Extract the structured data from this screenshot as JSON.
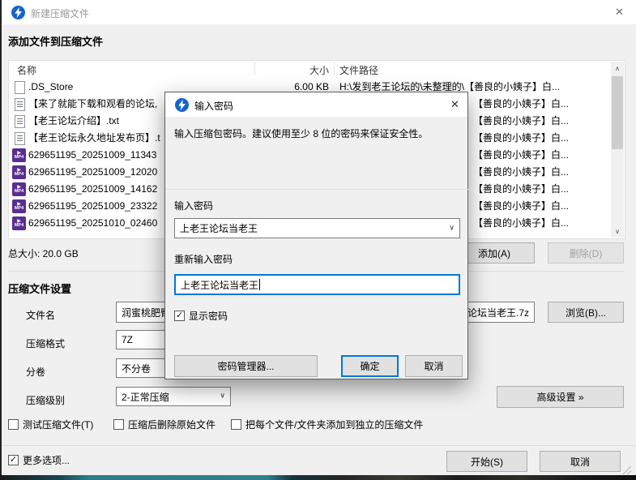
{
  "window": {
    "title": "新建压缩文件",
    "add_section_header": "添加文件到压缩文件",
    "total_size": "总大小: 20.0 GB"
  },
  "list": {
    "columns": {
      "name": "名称",
      "size": "大小",
      "path": "文件路径"
    },
    "rows": [
      {
        "icon": "blank-file",
        "name": ".DS_Store",
        "size": "6.00 KB",
        "path": "H:\\发到老王论坛的\\未整理的\\【善良的小姨子】白..."
      },
      {
        "icon": "text-file",
        "name": "【来了就能下载和观看的论坛,",
        "size": "",
        "path": "【善良的小姨子】白..."
      },
      {
        "icon": "text-file",
        "name": "【老王论坛介绍】.txt",
        "size": "",
        "path": "【善良的小姨子】白..."
      },
      {
        "icon": "text-file",
        "name": "【老王论坛永久地址发布页】.t",
        "size": "",
        "path": "【善良的小姨子】白..."
      },
      {
        "icon": "mp4-file",
        "name": "629651195_20251009_11343",
        "size": "",
        "path": "【善良的小姨子】白..."
      },
      {
        "icon": "mp4-file",
        "name": "629651195_20251009_12020",
        "size": "",
        "path": "【善良的小姨子】白..."
      },
      {
        "icon": "mp4-file",
        "name": "629651195_20251009_14162",
        "size": "",
        "path": "【善良的小姨子】白..."
      },
      {
        "icon": "mp4-file",
        "name": "629651195_20251009_23322",
        "size": "",
        "path": "【善良的小姨子】白..."
      },
      {
        "icon": "mp4-file",
        "name": "629651195_20251010_02460",
        "size": "",
        "path": "【善良的小姨子】白..."
      }
    ]
  },
  "buttons": {
    "add": "添加(A)",
    "delete": "删除(D)",
    "browse": "浏览(B)...",
    "advanced": "高级设置 »",
    "start": "开始(S)",
    "cancel": "取消"
  },
  "settings": {
    "header": "压缩文件设置",
    "filename_label": "文件名",
    "filename_left": "润蜜桃肥臀",
    "filename_right": "论坛当老王.7z",
    "format_label": "压缩格式",
    "format_value": "7Z",
    "volume_label": "分卷",
    "volume_value": "不分卷",
    "level_label": "压缩级别",
    "level_value": "2-正常压缩",
    "cb_test": "测试压缩文件(T)",
    "cb_delete_original": "压缩后删除原始文件",
    "cb_separate_archives": "把每个文件/文件夹添加到独立的压缩文件",
    "more_options": "更多选项..."
  },
  "dialog": {
    "title": "输入密码",
    "message": "输入压缩包密码。建议使用至少 8 位的密码来保证安全性。",
    "password_label": "输入密码",
    "password_value": "上老王论坛当老王",
    "confirm_label": "重新输入密码",
    "confirm_value": "上老王论坛当老王",
    "show_password_label": "显示密码",
    "buttons": {
      "manager": "密码管理器...",
      "ok": "确定",
      "cancel": "取消"
    }
  },
  "icons": {
    "close": "✕",
    "check": "✓",
    "chevron_down": "∨",
    "scroll_up": "∧",
    "scroll_down": "∨",
    "play": "▶",
    "mp4_label": "MP4"
  },
  "colors": {
    "accent": "#0078d7",
    "mp4_icon": "#5b2d90",
    "app_icon": "#1565c8",
    "window_bg": "#f0f0f0"
  }
}
